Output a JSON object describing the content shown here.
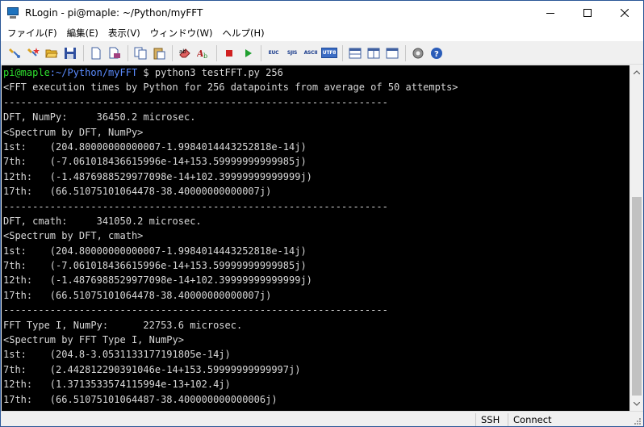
{
  "window": {
    "title": "RLogin - pi@maple: ~/Python/myFFT"
  },
  "menu": [
    {
      "label": "ファイル(F)"
    },
    {
      "label": "編集(E)"
    },
    {
      "label": "表示(V)"
    },
    {
      "label": "ウィンドウ(W)"
    },
    {
      "label": "ヘルプ(H)"
    }
  ],
  "toolbar": {
    "codes": [
      "EUC",
      "SJIS",
      "ASCII",
      "UTF8"
    ],
    "active_code": "UTF8"
  },
  "terminal": {
    "prompt_user": "pi@maple",
    "prompt_path": ":~/Python/myFFT",
    "prompt_symbol": " $ ",
    "command": "python3 testFFT.py 256",
    "lines": [
      "<FFT execution times by Python for 256 datapoints from average of 50 attempts>",
      "------------------------------------------------------------------",
      "DFT, NumPy:     36450.2 microsec.",
      "<Spectrum by DFT, NumPy>",
      "1st:    (204.80000000000007-1.9984014443252818e-14j)",
      "7th:    (-7.061018436615996e-14+153.59999999999985j)",
      "12th:   (-1.4876988529977098e-14+102.39999999999999j)",
      "17th:   (66.51075101064478-38.40000000000007j)",
      "------------------------------------------------------------------",
      "DFT, cmath:     341050.2 microsec.",
      "<Spectrum by DFT, cmath>",
      "1st:    (204.80000000000007-1.9984014443252818e-14j)",
      "7th:    (-7.061018436615996e-14+153.59999999999985j)",
      "12th:   (-1.4876988529977098e-14+102.39999999999999j)",
      "17th:   (66.51075101064478-38.40000000000007j)",
      "------------------------------------------------------------------",
      "FFT Type I, NumPy:      22753.6 microsec.",
      "<Spectrum by FFT Type I, NumPy>",
      "1st:    (204.8-3.0531133177191805e-14j)",
      "7th:    (2.442812290391046e-14+153.59999999999997j)",
      "12th:   (1.3713533574115994e-13+102.4j)",
      "17th:   (66.51075101064487-38.400000000000006j)"
    ]
  },
  "status": {
    "protocol": "SSH",
    "state": "Connect"
  }
}
